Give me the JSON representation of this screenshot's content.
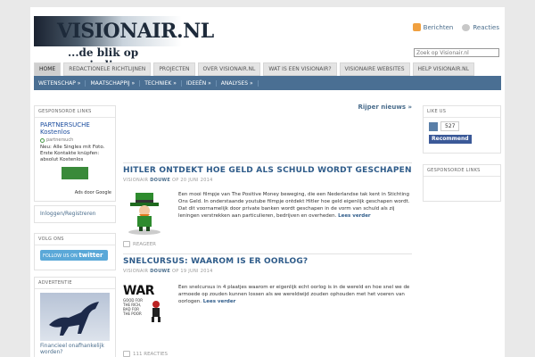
{
  "site": {
    "title": "VISIONAIR.NL",
    "subtitle": "...de blik op oneindig"
  },
  "feeds": {
    "posts": "Berichten",
    "comments": "Reacties"
  },
  "search": {
    "placeholder": "Zoek op Visionair.nl"
  },
  "topnav": [
    "HOME",
    "REDACTIONELE RICHTLIJNEN",
    "PROJECTEN",
    "OVER VISIONAIR.NL",
    "WAT IS EEN VISIONAIR?",
    "VISIONAIRE WEBSITES",
    "HELP VISIONAIR.NL"
  ],
  "catnav": [
    "WETENSCHAP »",
    "MAATSCHAPPIJ »",
    "TECHNIEK »",
    "IDEEËN »",
    "ANALYSES »"
  ],
  "left_sidebar": {
    "sponsored_heading": "GESPONSORDE LINKS",
    "ad": {
      "title": "PARTNERSUCHE Kostenlos",
      "partner": "partnersuch",
      "text": "Neu: Alle Singles mit Foto. Erste Kontakte knüpfen: absolut Kostenlos",
      "google": "Ads door Google"
    },
    "login": "Inloggen/Registreren",
    "follow_heading": "VOLG ONS",
    "twitter": {
      "prefix": "FOLLOW US ON",
      "brand": "twitter"
    },
    "advert_heading": "ADVERTENTIE",
    "advert_caption": "Financieel onafhankelijk worden?"
  },
  "main": {
    "rijper": "Rijper nieuws »",
    "posts": [
      {
        "title": "HITLER ONTDEKT HOE GELD ALS SCHULD WORDT GESCHAPEN",
        "category": "VISIONAIR",
        "author": "DOUWE",
        "date": "OP 20 JUNI 2014",
        "excerpt": "Een mooi filmpje van The Positive Money beweging, die een Nederlandse tak kent in Stichting Ons Geld. In onderstaande youtube filmpje ontdekt Hitler hoe geld eigenlijk geschapen wordt. Dat dit voornamelijk door private banken wordt geschapen in de vorm van schuld als zij leningen verstrekken aan particulieren, bedrijven en overheden.",
        "more": "Lees verder",
        "comments": "REAGEER"
      },
      {
        "title": "SNELCURSUS: WAAROM IS ER OORLOG?",
        "category": "VISIONAIR",
        "author": "DOUWE",
        "date": "OP 19 JUNI 2014",
        "excerpt": "Een snelcursus in 4 plaatjes waarom er eigenlijk echt oorlog is in de wereld en hoe snel we de armoede op zouden kunnen lossen als we wereldwijd zouden ophouden met het voeren van oorlogen.",
        "more": "Lees verder",
        "comments": "111 REACTIES",
        "thumb_word": "WAR",
        "thumb_caption": "GOOD FOR THE RICH, BAD FOR THE POOR"
      }
    ]
  },
  "right_sidebar": {
    "like_heading": "LIKE US",
    "like_count": "527",
    "recommend": "Recommend",
    "sponsored_heading": "GESPONSORDE LINKS"
  },
  "colors": {
    "nav_blue": "#4a6f93",
    "link_blue": "#2f5c8a",
    "facebook": "#3b5998",
    "twitter": "#5aa8d8"
  }
}
